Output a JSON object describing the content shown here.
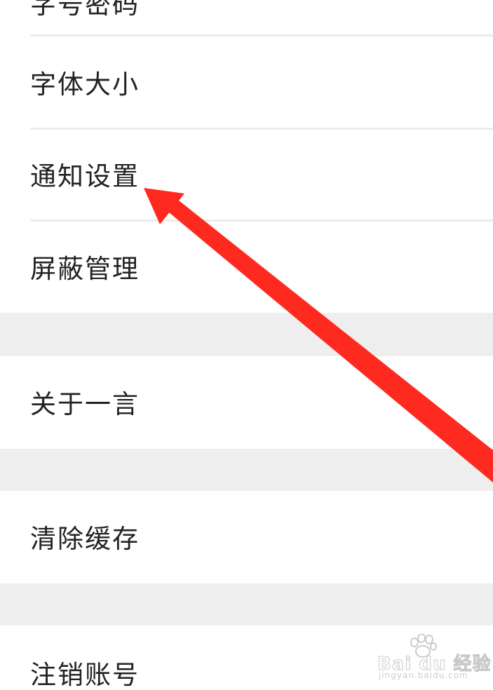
{
  "settings": {
    "items": [
      {
        "label": "字号密码"
      },
      {
        "label": "字体大小"
      },
      {
        "label": "通知设置"
      },
      {
        "label": "屏蔽管理"
      },
      {
        "label": "关于一言"
      },
      {
        "label": "清除缓存"
      },
      {
        "label": "注销账号"
      }
    ]
  },
  "annotation": {
    "arrow_color": "#ff2a1f",
    "points_to": "通知设置"
  },
  "watermark": {
    "brand": "Bai du 经验",
    "domain": "jingyan.baidu.com"
  },
  "colors": {
    "background": "#ffffff",
    "section_gap": "#efeeef",
    "divider": "#ececec",
    "text": "#222222"
  }
}
